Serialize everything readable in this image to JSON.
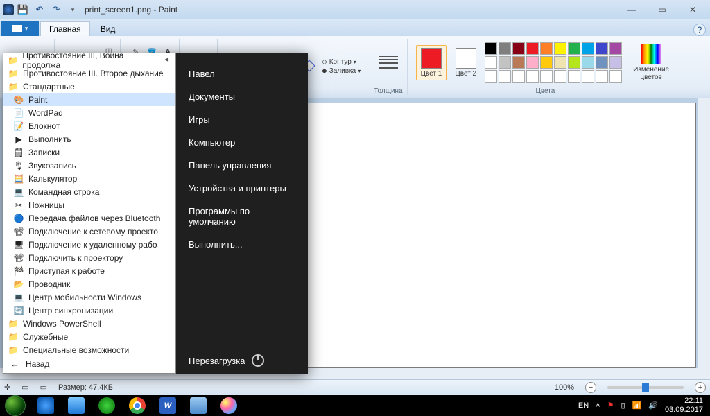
{
  "window": {
    "title": "print_screen1.png - Paint",
    "tabs": {
      "file": "",
      "main": "Главная",
      "view": "Вид"
    }
  },
  "ribbon": {
    "clipboard": "",
    "select": "",
    "tools": "",
    "shapes": "",
    "outline": "Контур",
    "fill": "Заливка",
    "thickness": "Толщина",
    "color1": "Цвет 1",
    "color2": "Цвет 2",
    "edit_colors": "Изменение цветов",
    "colors_group": "Цвета",
    "palette_row1": [
      "#000000",
      "#7f7f7f",
      "#880015",
      "#ed1c24",
      "#ff7f27",
      "#fff200",
      "#22b14c",
      "#00a2e8",
      "#3f48cc",
      "#a349a4"
    ],
    "palette_row2": [
      "#ffffff",
      "#c3c3c3",
      "#b97a57",
      "#ffaec9",
      "#ffc90e",
      "#efe4b0",
      "#b5e61d",
      "#99d9ea",
      "#7092be",
      "#c8bfe7"
    ],
    "palette_row3": [
      "#ffffff",
      "#ffffff",
      "#ffffff",
      "#ffffff",
      "#ffffff",
      "#ffffff",
      "#ffffff",
      "#ffffff",
      "#ffffff",
      "#ffffff"
    ]
  },
  "status": {
    "size_label": "Размер: 47,4КБ",
    "zoom": "100%"
  },
  "start_menu": {
    "left_items": [
      {
        "label": "Противостояние III, Война продолжа",
        "type": "folder",
        "arrow": true
      },
      {
        "label": "Противостояние III. Второе дыхание",
        "type": "folder"
      },
      {
        "label": "Стандартные",
        "type": "folder"
      },
      {
        "label": "Paint",
        "type": "app",
        "selected": true
      },
      {
        "label": "WordPad",
        "type": "app"
      },
      {
        "label": "Блокнот",
        "type": "app"
      },
      {
        "label": "Выполнить",
        "type": "app"
      },
      {
        "label": "Записки",
        "type": "app"
      },
      {
        "label": "Звукозапись",
        "type": "app"
      },
      {
        "label": "Калькулятор",
        "type": "app"
      },
      {
        "label": "Командная строка",
        "type": "app"
      },
      {
        "label": "Ножницы",
        "type": "app"
      },
      {
        "label": "Передача файлов через Bluetooth",
        "type": "app"
      },
      {
        "label": "Подключение к сетевому проекто",
        "type": "app"
      },
      {
        "label": "Подключение к удаленному рабо",
        "type": "app"
      },
      {
        "label": "Подключить к проектору",
        "type": "app"
      },
      {
        "label": "Приступая к работе",
        "type": "app"
      },
      {
        "label": "Проводник",
        "type": "app"
      },
      {
        "label": "Центр мобильности Windows",
        "type": "app"
      },
      {
        "label": "Центр синхронизации",
        "type": "app"
      },
      {
        "label": "Windows PowerShell",
        "type": "folder"
      },
      {
        "label": "Служебные",
        "type": "folder"
      },
      {
        "label": "Специальные возможности",
        "type": "folder"
      }
    ],
    "back": "Назад",
    "right_items": [
      "Павел",
      "Документы",
      "Игры",
      "Компьютер",
      "Панель управления",
      "Устройства и принтеры",
      "Программы по умолчанию",
      "Выполнить..."
    ],
    "restart": "Перезагрузка"
  },
  "taskbar": {
    "lang": "EN",
    "time": "22:11",
    "date": "03.09.2017"
  }
}
